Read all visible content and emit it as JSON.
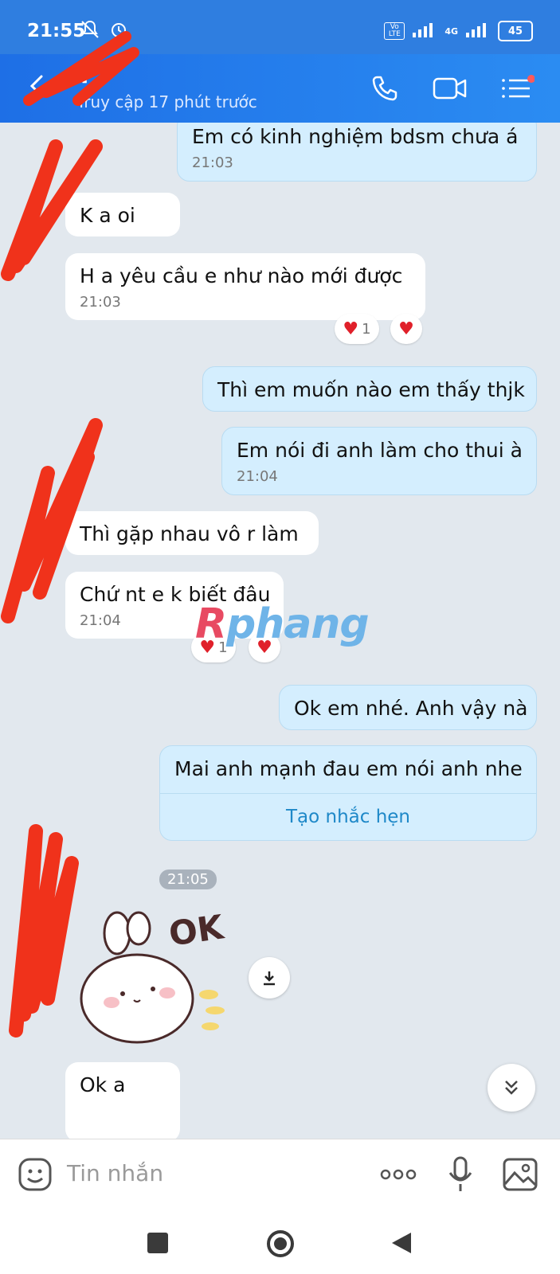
{
  "status": {
    "time": "21:55",
    "network_1": "Vo LTE",
    "network_2": "4G",
    "battery": "45"
  },
  "header": {
    "contact_name": "Y",
    "last_seen": "Truy cập 17 phút trước"
  },
  "messages": [
    {
      "dir": "out",
      "text": "Em có kinh nghiệm bdsm chưa á",
      "time": "21:03"
    },
    {
      "dir": "in",
      "text": "K a oi"
    },
    {
      "dir": "in",
      "text": "H a yêu cầu e như nào mới được",
      "time": "21:03",
      "reaction_count": "1"
    },
    {
      "dir": "out",
      "text": "Thì em muốn nào em thấy thjk"
    },
    {
      "dir": "out",
      "text": "Em nói đi anh làm cho thui à",
      "time": "21:04"
    },
    {
      "dir": "in",
      "text": "Thì gặp nhau vô r làm"
    },
    {
      "dir": "in",
      "text": "Chứ nt e k biết đâu",
      "time": "21:04",
      "reaction_count": "1"
    },
    {
      "dir": "out",
      "text": "Ok em nhé. Anh vậy nà"
    },
    {
      "dir": "out",
      "text": "Mai anh mạnh đau em nói anh nhe",
      "action": "Tạo nhắc hẹn",
      "time": "21:05"
    },
    {
      "dir": "in",
      "text": "Ok a"
    }
  ],
  "sticker": {
    "text": "OK"
  },
  "watermark": {
    "first": "R",
    "rest": "phang"
  },
  "composer": {
    "placeholder": "Tin nhắn"
  },
  "colors": {
    "header": "#2b8cf2",
    "outgoing_bubble": "#d4eefe",
    "incoming_bubble": "#ffffff",
    "chat_bg": "#e2e8ee",
    "heart": "#e0202a"
  }
}
